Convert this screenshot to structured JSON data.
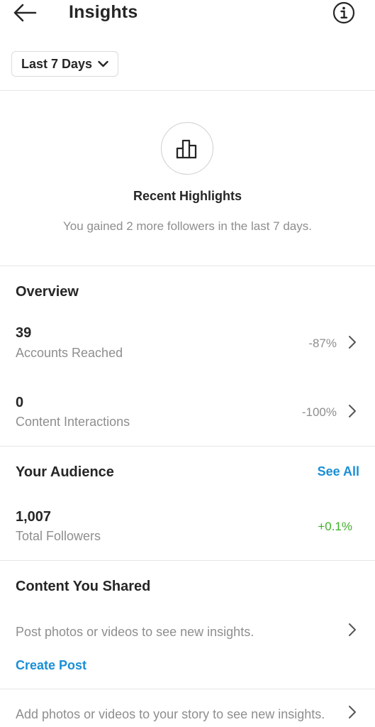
{
  "header": {
    "title": "Insights",
    "back_icon": "arrow-left-icon",
    "info_icon": "info-circle-icon"
  },
  "date_range": {
    "selected": "Last 7 Days",
    "icon": "chevron-down-icon"
  },
  "highlights": {
    "icon": "bar-chart-icon",
    "title": "Recent Highlights",
    "subtitle": "You gained 2 more followers in the last 7 days."
  },
  "overview": {
    "title": "Overview",
    "metrics": [
      {
        "value": "39",
        "label": "Accounts Reached",
        "delta": "-87%"
      },
      {
        "value": "0",
        "label": "Content Interactions",
        "delta": "-100%"
      }
    ]
  },
  "audience": {
    "title": "Your Audience",
    "see_all": "See All",
    "value": "1,007",
    "label": "Total Followers",
    "delta": "+0.1%"
  },
  "content": {
    "title": "Content You Shared",
    "posts_hint": "Post photos or videos to see new insights.",
    "create_post": "Create Post",
    "story_hint": "Add photos or videos to your story to see new insights."
  },
  "colors": {
    "text": "#262626",
    "muted": "#8e8e8e",
    "link": "#1a8fd6",
    "positive": "#3fae29",
    "divider": "#e6e6e6"
  }
}
